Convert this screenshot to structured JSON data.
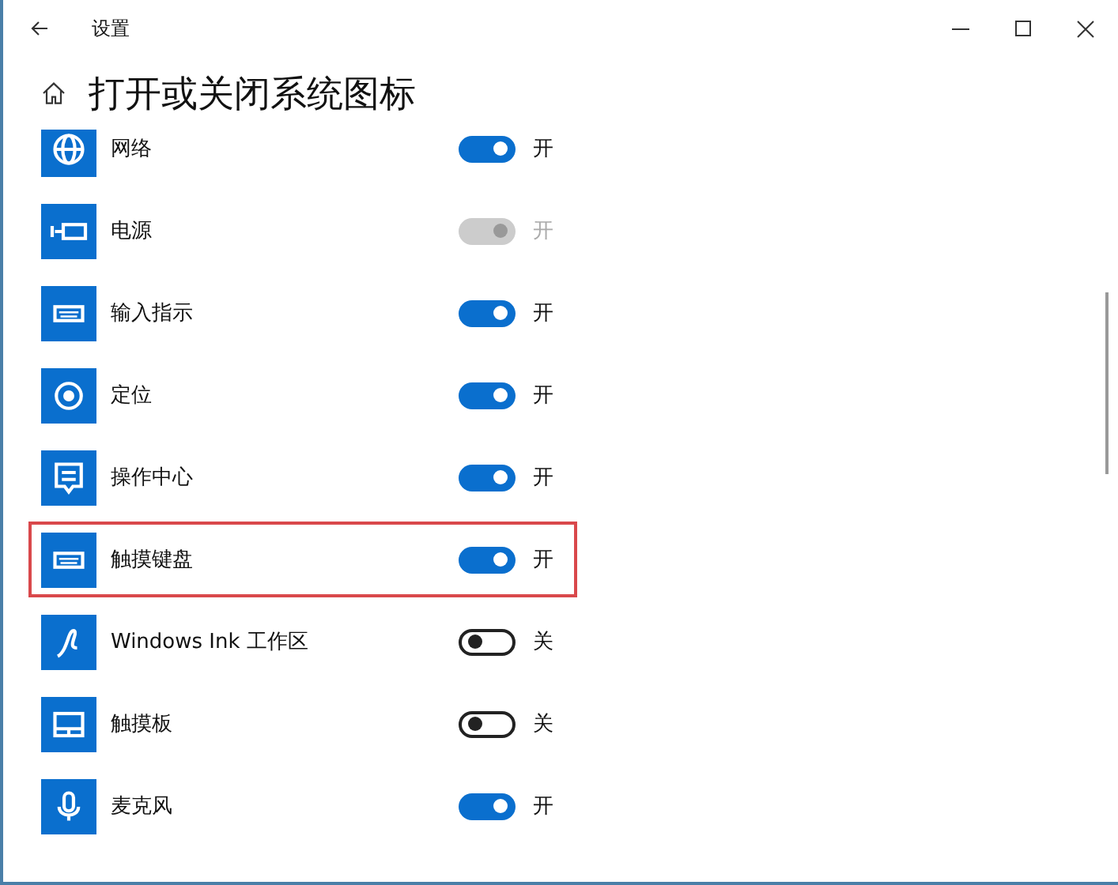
{
  "window": {
    "title": "设置"
  },
  "page": {
    "title": "打开或关闭系统图标"
  },
  "items": [
    {
      "label": "网络",
      "on": true,
      "disabled": false,
      "state": "开",
      "highlighted": false
    },
    {
      "label": "电源",
      "on": true,
      "disabled": true,
      "state": "开",
      "highlighted": false
    },
    {
      "label": "输入指示",
      "on": true,
      "disabled": false,
      "state": "开",
      "highlighted": false
    },
    {
      "label": "定位",
      "on": true,
      "disabled": false,
      "state": "开",
      "highlighted": false
    },
    {
      "label": "操作中心",
      "on": true,
      "disabled": false,
      "state": "开",
      "highlighted": false
    },
    {
      "label": "触摸键盘",
      "on": true,
      "disabled": false,
      "state": "开",
      "highlighted": true
    },
    {
      "label": "Windows Ink 工作区",
      "on": false,
      "disabled": false,
      "state": "关",
      "highlighted": false
    },
    {
      "label": "触摸板",
      "on": false,
      "disabled": false,
      "state": "关",
      "highlighted": false
    },
    {
      "label": "麦克风",
      "on": true,
      "disabled": false,
      "state": "开",
      "highlighted": false
    }
  ]
}
